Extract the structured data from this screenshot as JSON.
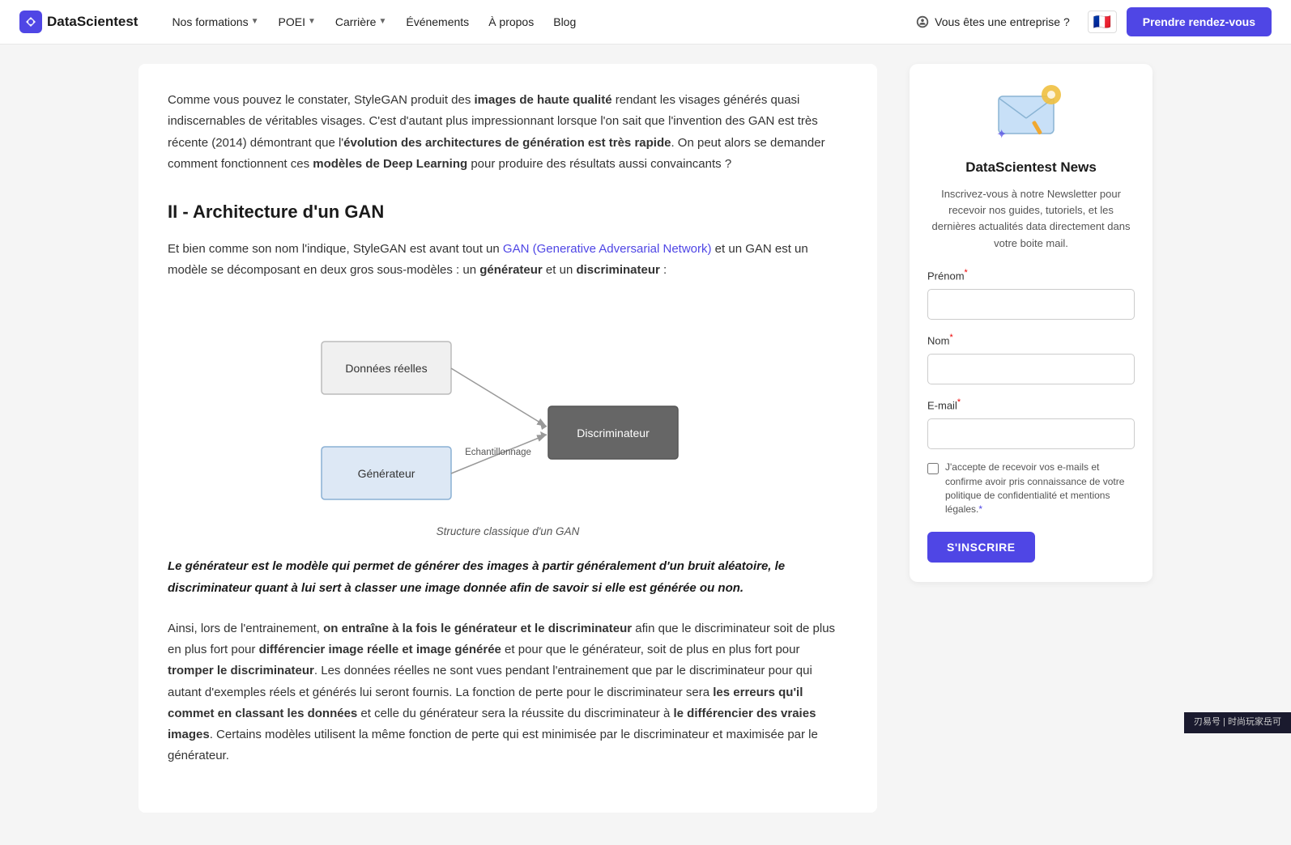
{
  "navbar": {
    "logo_text": "DataScientest",
    "nav_items": [
      {
        "label": "Nos formations",
        "has_dropdown": true
      },
      {
        "label": "POEI",
        "has_dropdown": true
      },
      {
        "label": "Carrière",
        "has_dropdown": true
      },
      {
        "label": "Événements",
        "has_dropdown": false
      },
      {
        "label": "À propos",
        "has_dropdown": false
      },
      {
        "label": "Blog",
        "has_dropdown": false
      }
    ],
    "enterprise_label": "Vous êtes une entreprise ?",
    "flag_emoji": "🇫🇷",
    "cta_label": "Prendre rendez-vous"
  },
  "article": {
    "intro": "Comme vous pouvez le constater, StyleGAN produit des images de haute qualité rendant les visages générés quasi indiscernables de véritables visages. C'est d'autant plus impressionnant lorsque l'on sait que l'invention des GAN est très récente (2014) démontrant que l'évolution des architectures de génération est très rapide. On peut alors se demander comment fonctionnent ces modèles de Deep Learning pour produire des résultats aussi convaincants ?",
    "section_title": "II - Architecture d'un GAN",
    "body_p1_before": "Et bien comme son nom l'indique, StyleGAN est avant tout un ",
    "body_p1_link": "GAN (Generative Adversarial Network)",
    "body_p1_after": " et un GAN est un modèle se décomposant en deux gros sous-modèles : un générateur et un discriminateur :",
    "diagram_caption": "Structure classique d'un GAN",
    "diagram": {
      "donnees_label": "Données réelles",
      "generateur_label": "Générateur",
      "discriminateur_label": "Discriminateur",
      "echantillonnage_label": "Echantillonnage"
    },
    "quote": "Le générateur est le modèle qui permet de générer des images à partir généralement d'un bruit aléatoire, le discriminateur quant à lui sert à classer une image donnée afin de savoir si elle est générée ou non.",
    "body_p2": "Ainsi, lors de l'entrainement, on entraîne à la fois le générateur et le discriminateur afin que le discriminateur soit de plus en plus fort pour différencier image réelle et image générée et pour que le générateur, soit de plus en plus fort pour tromper le discriminateur. Les données réelles ne sont vues pendant l'entrainement que par le discriminateur pour qui autant d'exemples réels et générés lui seront fournis. La fonction de perte pour le discriminateur sera les erreurs qu'il commet en classant les données et celle du générateur sera la réussite du discriminateur à le différencier des vraies images. Certains modèles utilisent la même fonction de perte qui est minimisée par le discriminateur et maximisée par le générateur."
  },
  "sidebar": {
    "newsletter_title": "DataScientest News",
    "newsletter_desc": "Inscrivez-vous à notre Newsletter pour recevoir nos guides, tutoriels, et les dernières actualités data directement dans votre boite mail.",
    "prenom_label": "Prénom",
    "nom_label": "Nom",
    "email_label": "E-mail",
    "prenom_placeholder": "",
    "nom_placeholder": "",
    "email_placeholder": "",
    "checkbox_label": "J'accepte de recevoir vos e-mails et confirme avoir pris connaissance de votre politique de confidentialité et mentions légales.",
    "submit_label": "S'INSCRIRE"
  },
  "watermark": "刃易号 | 时尚玩家岳可"
}
